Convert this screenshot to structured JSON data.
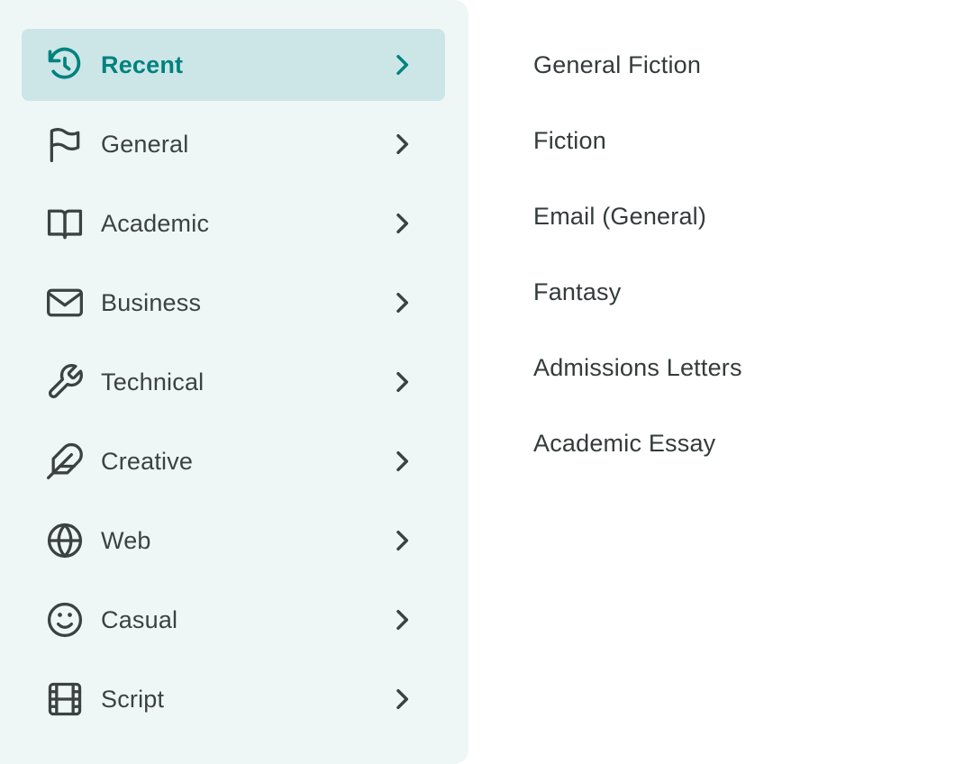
{
  "colors": {
    "panel_bg": "#eff7f6",
    "active_bg": "#cce6e7",
    "accent": "#00827f",
    "text": "#3c4142"
  },
  "categories": [
    {
      "label": "Recent",
      "icon": "history-icon",
      "active": true
    },
    {
      "label": "General",
      "icon": "flag-icon",
      "active": false
    },
    {
      "label": "Academic",
      "icon": "book-open-icon",
      "active": false
    },
    {
      "label": "Business",
      "icon": "mail-icon",
      "active": false
    },
    {
      "label": "Technical",
      "icon": "wrench-icon",
      "active": false
    },
    {
      "label": "Creative",
      "icon": "feather-icon",
      "active": false
    },
    {
      "label": "Web",
      "icon": "globe-icon",
      "active": false
    },
    {
      "label": "Casual",
      "icon": "smile-icon",
      "active": false
    },
    {
      "label": "Script",
      "icon": "film-icon",
      "active": false
    }
  ],
  "subitems": [
    {
      "label": "General Fiction"
    },
    {
      "label": "Fiction"
    },
    {
      "label": "Email (General)"
    },
    {
      "label": "Fantasy"
    },
    {
      "label": "Admissions Letters"
    },
    {
      "label": "Academic Essay"
    }
  ]
}
